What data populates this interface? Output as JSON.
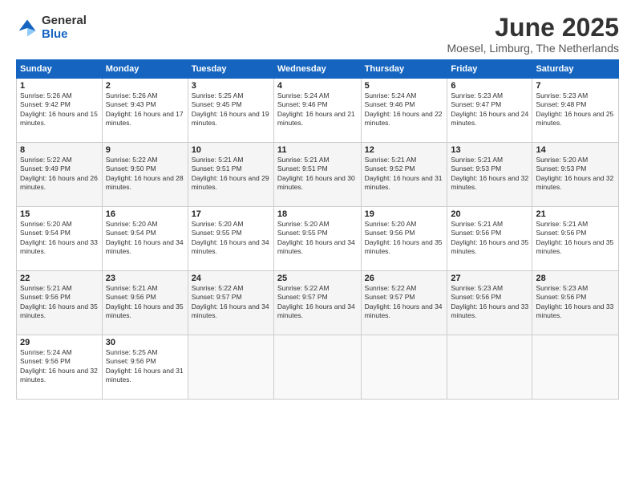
{
  "logo": {
    "general": "General",
    "blue": "Blue"
  },
  "title": "June 2025",
  "location": "Moesel, Limburg, The Netherlands",
  "weekdays": [
    "Sunday",
    "Monday",
    "Tuesday",
    "Wednesday",
    "Thursday",
    "Friday",
    "Saturday"
  ],
  "weeks": [
    [
      {
        "day": "1",
        "sunrise": "5:26 AM",
        "sunset": "9:42 PM",
        "daylight": "16 hours and 15 minutes."
      },
      {
        "day": "2",
        "sunrise": "5:26 AM",
        "sunset": "9:43 PM",
        "daylight": "16 hours and 17 minutes."
      },
      {
        "day": "3",
        "sunrise": "5:25 AM",
        "sunset": "9:45 PM",
        "daylight": "16 hours and 19 minutes."
      },
      {
        "day": "4",
        "sunrise": "5:24 AM",
        "sunset": "9:46 PM",
        "daylight": "16 hours and 21 minutes."
      },
      {
        "day": "5",
        "sunrise": "5:24 AM",
        "sunset": "9:46 PM",
        "daylight": "16 hours and 22 minutes."
      },
      {
        "day": "6",
        "sunrise": "5:23 AM",
        "sunset": "9:47 PM",
        "daylight": "16 hours and 24 minutes."
      },
      {
        "day": "7",
        "sunrise": "5:23 AM",
        "sunset": "9:48 PM",
        "daylight": "16 hours and 25 minutes."
      }
    ],
    [
      {
        "day": "8",
        "sunrise": "5:22 AM",
        "sunset": "9:49 PM",
        "daylight": "16 hours and 26 minutes."
      },
      {
        "day": "9",
        "sunrise": "5:22 AM",
        "sunset": "9:50 PM",
        "daylight": "16 hours and 28 minutes."
      },
      {
        "day": "10",
        "sunrise": "5:21 AM",
        "sunset": "9:51 PM",
        "daylight": "16 hours and 29 minutes."
      },
      {
        "day": "11",
        "sunrise": "5:21 AM",
        "sunset": "9:51 PM",
        "daylight": "16 hours and 30 minutes."
      },
      {
        "day": "12",
        "sunrise": "5:21 AM",
        "sunset": "9:52 PM",
        "daylight": "16 hours and 31 minutes."
      },
      {
        "day": "13",
        "sunrise": "5:21 AM",
        "sunset": "9:53 PM",
        "daylight": "16 hours and 32 minutes."
      },
      {
        "day": "14",
        "sunrise": "5:20 AM",
        "sunset": "9:53 PM",
        "daylight": "16 hours and 32 minutes."
      }
    ],
    [
      {
        "day": "15",
        "sunrise": "5:20 AM",
        "sunset": "9:54 PM",
        "daylight": "16 hours and 33 minutes."
      },
      {
        "day": "16",
        "sunrise": "5:20 AM",
        "sunset": "9:54 PM",
        "daylight": "16 hours and 34 minutes."
      },
      {
        "day": "17",
        "sunrise": "5:20 AM",
        "sunset": "9:55 PM",
        "daylight": "16 hours and 34 minutes."
      },
      {
        "day": "18",
        "sunrise": "5:20 AM",
        "sunset": "9:55 PM",
        "daylight": "16 hours and 34 minutes."
      },
      {
        "day": "19",
        "sunrise": "5:20 AM",
        "sunset": "9:56 PM",
        "daylight": "16 hours and 35 minutes."
      },
      {
        "day": "20",
        "sunrise": "5:21 AM",
        "sunset": "9:56 PM",
        "daylight": "16 hours and 35 minutes."
      },
      {
        "day": "21",
        "sunrise": "5:21 AM",
        "sunset": "9:56 PM",
        "daylight": "16 hours and 35 minutes."
      }
    ],
    [
      {
        "day": "22",
        "sunrise": "5:21 AM",
        "sunset": "9:56 PM",
        "daylight": "16 hours and 35 minutes."
      },
      {
        "day": "23",
        "sunrise": "5:21 AM",
        "sunset": "9:56 PM",
        "daylight": "16 hours and 35 minutes."
      },
      {
        "day": "24",
        "sunrise": "5:22 AM",
        "sunset": "9:57 PM",
        "daylight": "16 hours and 34 minutes."
      },
      {
        "day": "25",
        "sunrise": "5:22 AM",
        "sunset": "9:57 PM",
        "daylight": "16 hours and 34 minutes."
      },
      {
        "day": "26",
        "sunrise": "5:22 AM",
        "sunset": "9:57 PM",
        "daylight": "16 hours and 34 minutes."
      },
      {
        "day": "27",
        "sunrise": "5:23 AM",
        "sunset": "9:56 PM",
        "daylight": "16 hours and 33 minutes."
      },
      {
        "day": "28",
        "sunrise": "5:23 AM",
        "sunset": "9:56 PM",
        "daylight": "16 hours and 33 minutes."
      }
    ],
    [
      {
        "day": "29",
        "sunrise": "5:24 AM",
        "sunset": "9:56 PM",
        "daylight": "16 hours and 32 minutes."
      },
      {
        "day": "30",
        "sunrise": "5:25 AM",
        "sunset": "9:56 PM",
        "daylight": "16 hours and 31 minutes."
      },
      null,
      null,
      null,
      null,
      null
    ]
  ]
}
